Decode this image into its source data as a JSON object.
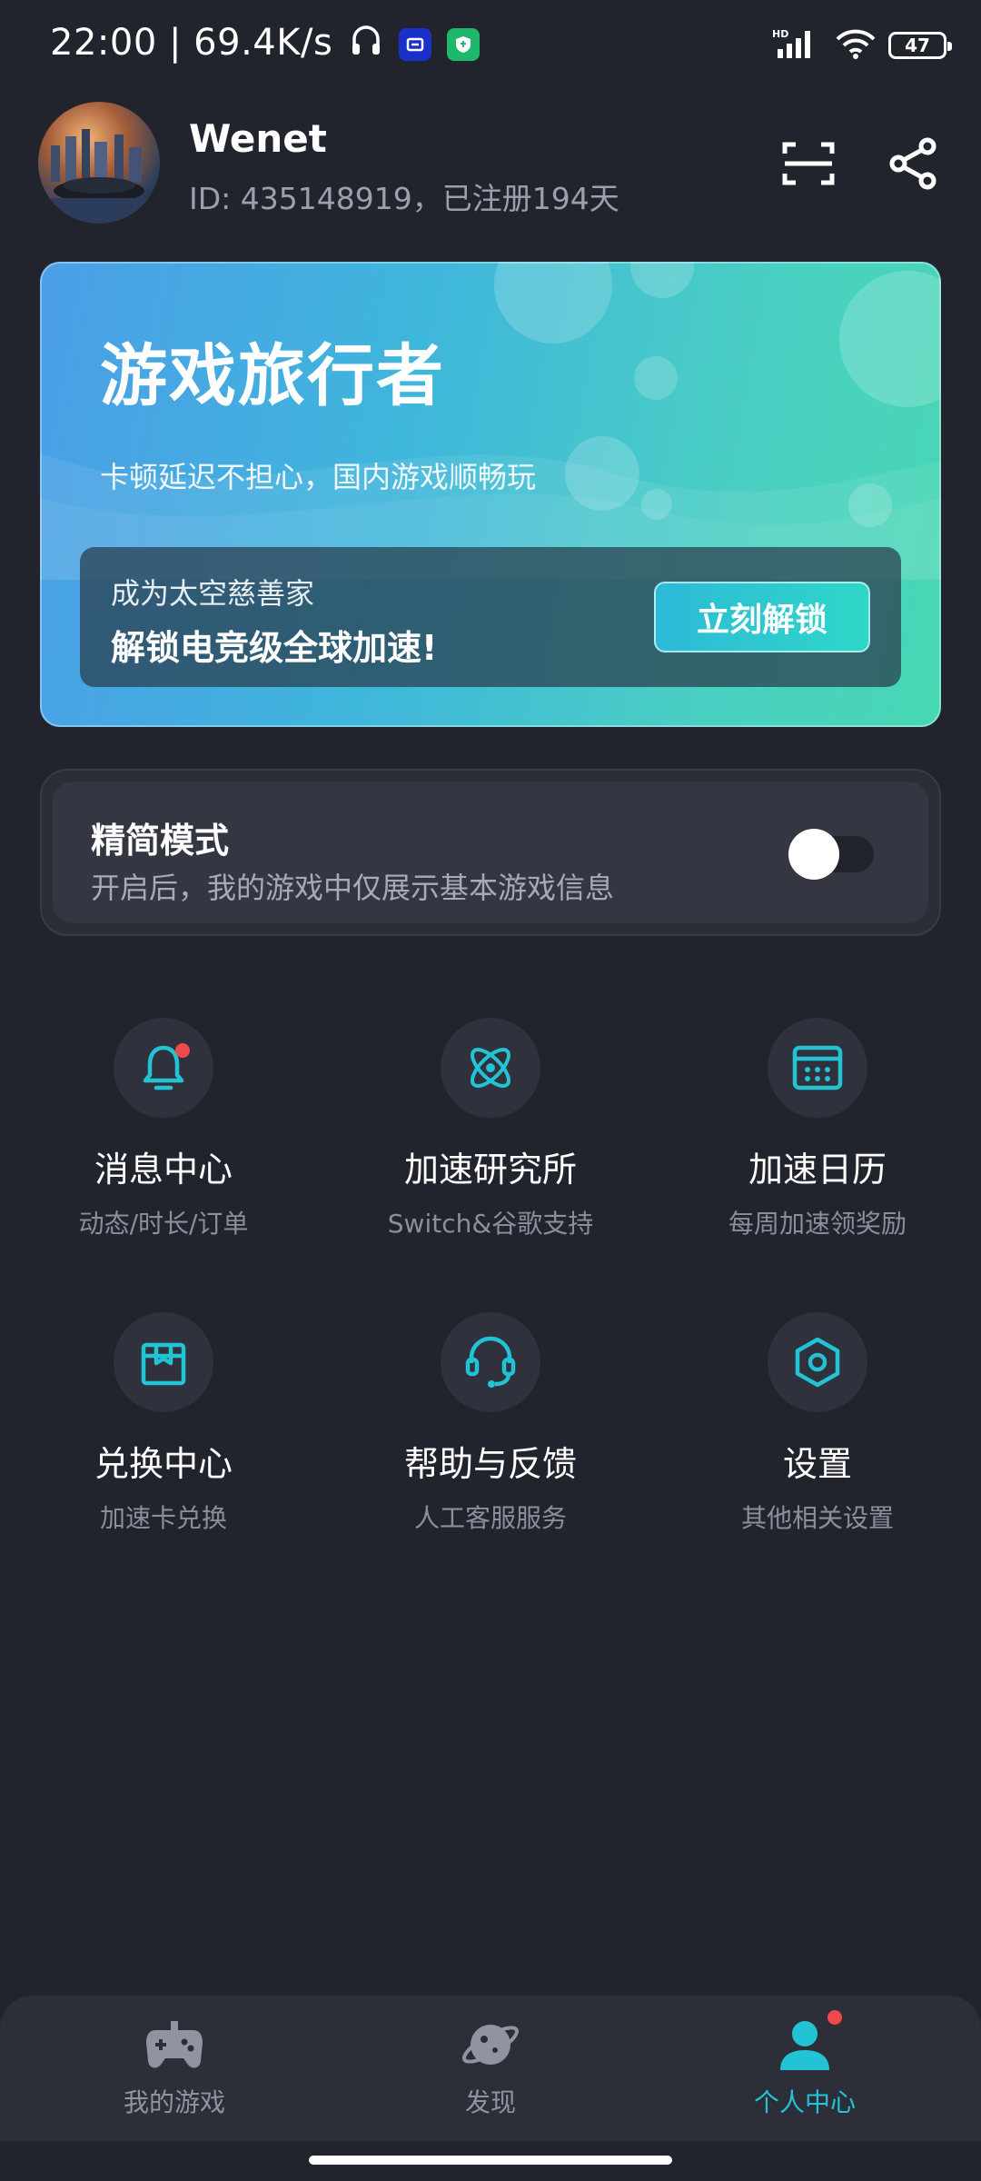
{
  "status_bar": {
    "time_speed": "22:00 | 69.4K/s",
    "network": "HD",
    "battery": "47"
  },
  "profile": {
    "username": "Wenet",
    "id_line": "ID: 435148919，已注册194天"
  },
  "vip_card": {
    "title": "游戏旅行者",
    "subtitle": "卡顿延迟不担心，国内游戏顺畅玩",
    "promo_line1": "成为太空慈善家",
    "promo_line2": "解锁电竞级全球加速!",
    "unlock_button": "立刻解锁"
  },
  "simple_mode": {
    "title": "精简模式",
    "description": "开启后，我的游戏中仅展示基本游戏信息",
    "enabled": false
  },
  "grid": [
    {
      "title": "消息中心",
      "subtitle": "动态/时长/订单",
      "icon": "bell-icon"
    },
    {
      "title": "加速研究所",
      "subtitle": "Switch&谷歌支持",
      "icon": "atom-icon"
    },
    {
      "title": "加速日历",
      "subtitle": "每周加速领奖励",
      "icon": "calendar-icon"
    },
    {
      "title": "兑换中心",
      "subtitle": "加速卡兑换",
      "icon": "exchange-box-icon"
    },
    {
      "title": "帮助与反馈",
      "subtitle": "人工客服服务",
      "icon": "headset-icon"
    },
    {
      "title": "设置",
      "subtitle": "其他相关设置",
      "icon": "settings-icon"
    }
  ],
  "bottom_nav": [
    {
      "label": "我的游戏",
      "icon": "gamepad-icon",
      "active": false
    },
    {
      "label": "发现",
      "icon": "planet-icon",
      "active": false
    },
    {
      "label": "个人中心",
      "icon": "person-icon",
      "active": true
    }
  ],
  "colors": {
    "accent": "#22c3d4",
    "background": "#22242d",
    "notification_dot": "#f04a4a"
  }
}
